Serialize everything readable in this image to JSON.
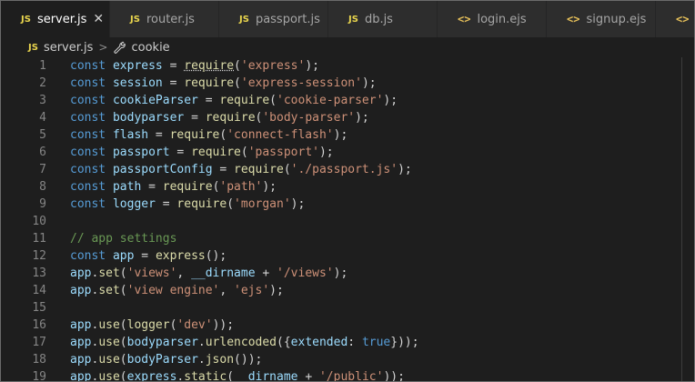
{
  "tabs": [
    {
      "icon": "JS",
      "label": "server.js",
      "active": true,
      "close": "✕"
    },
    {
      "icon": "JS",
      "label": "router.js"
    },
    {
      "icon": "JS",
      "label": "passport.js"
    },
    {
      "icon": "JS",
      "label": "db.js"
    },
    {
      "icon": "<>",
      "label": "login.ejs"
    },
    {
      "icon": "<>",
      "label": "signup.ejs"
    },
    {
      "icon": "<>",
      "label": ""
    }
  ],
  "breadcrumb": {
    "file_icon": "JS",
    "file": "server.js",
    "separator": ">",
    "symbol": "cookie"
  },
  "colors": {
    "keyword": "#569cd6",
    "variable": "#9cdcfe",
    "function": "#dcdcaa",
    "string": "#ce9178",
    "comment": "#6a9955"
  },
  "code": {
    "line_numbers": [
      "1",
      "2",
      "3",
      "4",
      "5",
      "6",
      "7",
      "8",
      "9",
      "10",
      "11",
      "12",
      "13",
      "14",
      "15",
      "16",
      "17",
      "18",
      "19"
    ],
    "l1": {
      "kw": "const",
      "name": "express",
      "eq": " = ",
      "fn": "require",
      "open": "(",
      "str": "'express'",
      "close": ");"
    },
    "l2": {
      "kw": "const",
      "name": "session",
      "eq": " = ",
      "fn": "require",
      "open": "(",
      "str": "'express-session'",
      "close": ");"
    },
    "l3": {
      "kw": "const",
      "name": "cookieParser",
      "eq": " = ",
      "fn": "require",
      "open": "(",
      "str": "'cookie-parser'",
      "close": ");"
    },
    "l4": {
      "kw": "const",
      "name": "bodyparser",
      "eq": " = ",
      "fn": "require",
      "open": "(",
      "str": "'body-parser'",
      "close": ");"
    },
    "l5": {
      "kw": "const",
      "name": "flash",
      "eq": " = ",
      "fn": "require",
      "open": "(",
      "str": "'connect-flash'",
      "close": ");"
    },
    "l6": {
      "kw": "const",
      "name": "passport",
      "eq": " = ",
      "fn": "require",
      "open": "(",
      "str": "'passport'",
      "close": ");"
    },
    "l7": {
      "kw": "const",
      "name": "passportConfig",
      "eq": " = ",
      "fn": "require",
      "open": "(",
      "str": "'./passport.js'",
      "close": ");"
    },
    "l8": {
      "kw": "const",
      "name": "path",
      "eq": " = ",
      "fn": "require",
      "open": "(",
      "str": "'path'",
      "close": ");"
    },
    "l9": {
      "kw": "const",
      "name": "logger",
      "eq": " = ",
      "fn": "require",
      "open": "(",
      "str": "'morgan'",
      "close": ");"
    },
    "l11": {
      "comment": "// app settings"
    },
    "l12": {
      "kw": "const",
      "name": "app",
      "eq": " = ",
      "fn": "express",
      "close": "();"
    },
    "l13": {
      "obj": "app",
      "dot": ".",
      "fn": "set",
      "open": "(",
      "str1": "'views'",
      "comma": ", ",
      "var": "__dirname",
      "plus": " + ",
      "str2": "'/views'",
      "close": ");"
    },
    "l14": {
      "obj": "app",
      "dot": ".",
      "fn": "set",
      "open": "(",
      "str1": "'view engine'",
      "comma": ", ",
      "str2": "'ejs'",
      "close": ");"
    },
    "l16": {
      "obj": "app",
      "dot": ".",
      "fn": "use",
      "open": "(",
      "fn2": "logger",
      "open2": "(",
      "str": "'dev'",
      "close": "));"
    },
    "l17": {
      "obj": "app",
      "dot": ".",
      "fn": "use",
      "open": "(",
      "obj2": "bodyparser",
      "dot2": ".",
      "fn2": "urlencoded",
      "open2": "({",
      "prop": "extended",
      "colon": ": ",
      "val": "true",
      "close": "}));"
    },
    "l18": {
      "obj": "app",
      "dot": ".",
      "fn": "use",
      "open": "(",
      "obj2": "bodyParser",
      "dot2": ".",
      "fn2": "json",
      "close": "());"
    },
    "l19": {
      "obj": "app",
      "dot": ".",
      "fn": "use",
      "open": "(",
      "obj2": "express",
      "dot2": ".",
      "fn2": "static",
      "open2": "(",
      "var": "__dirname",
      "plus": " + ",
      "str": "'/public'",
      "close": "));"
    }
  }
}
